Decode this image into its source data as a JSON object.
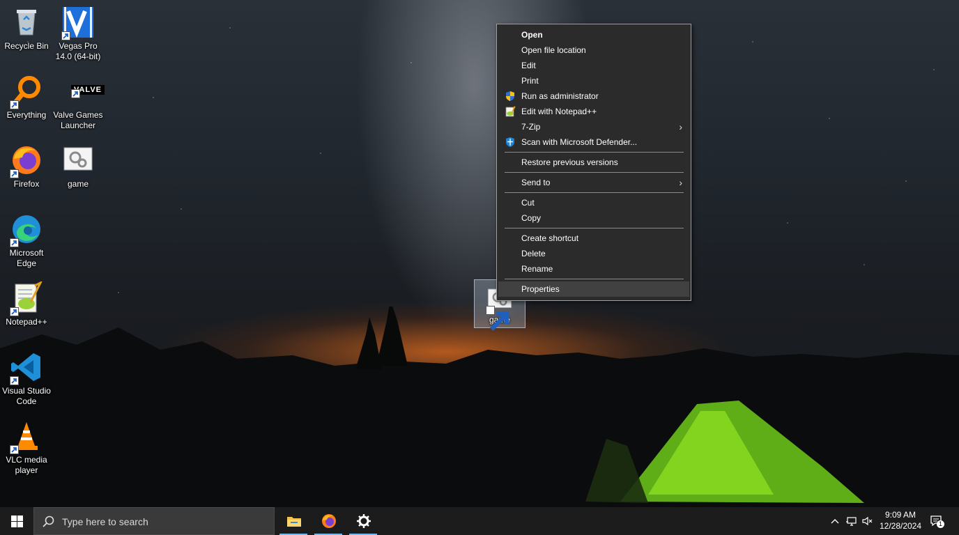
{
  "desktop": {
    "icons": [
      {
        "label": "Recycle Bin"
      },
      {
        "label": "Vegas Pro 14.0 (64-bit)"
      },
      {
        "label": "Everything"
      },
      {
        "label": "Valve Games Launcher"
      },
      {
        "label": "Firefox"
      },
      {
        "label": "game"
      },
      {
        "label": "Microsoft Edge"
      },
      {
        "label": "Notepad++"
      },
      {
        "label": "Visual Studio Code"
      },
      {
        "label": "VLC media player"
      }
    ],
    "valve_logo_text": "VALVE",
    "selected_icon": {
      "label": "game"
    }
  },
  "context_menu": {
    "items": [
      {
        "label": "Open"
      },
      {
        "label": "Open file location"
      },
      {
        "label": "Edit"
      },
      {
        "label": "Print"
      },
      {
        "label": "Run as administrator",
        "icon": "uac-shield-icon"
      },
      {
        "label": "Edit with Notepad++",
        "icon": "notepad-plus-plus-icon"
      },
      {
        "label": "7-Zip",
        "submenu": true
      },
      {
        "label": "Scan with Microsoft Defender...",
        "icon": "defender-shield-icon"
      },
      {
        "label": "Restore previous versions"
      },
      {
        "label": "Send to",
        "submenu": true
      },
      {
        "label": "Cut"
      },
      {
        "label": "Copy"
      },
      {
        "label": "Create shortcut"
      },
      {
        "label": "Delete"
      },
      {
        "label": "Rename"
      },
      {
        "label": "Properties",
        "hovered": true
      }
    ],
    "submenu_arrow": "›"
  },
  "taskbar": {
    "search_placeholder": "Type here to search",
    "pinned": [
      "file-explorer-icon",
      "firefox-icon",
      "settings-icon"
    ],
    "clock": {
      "time": "9:09 AM",
      "date": "12/28/2024"
    },
    "notification_count": "1"
  },
  "colors": {
    "menu_bg": "#2b2b2b",
    "menu_hover": "#414141",
    "taskbar_bg": "#1c1c1c",
    "accent": "#76b9ed"
  }
}
